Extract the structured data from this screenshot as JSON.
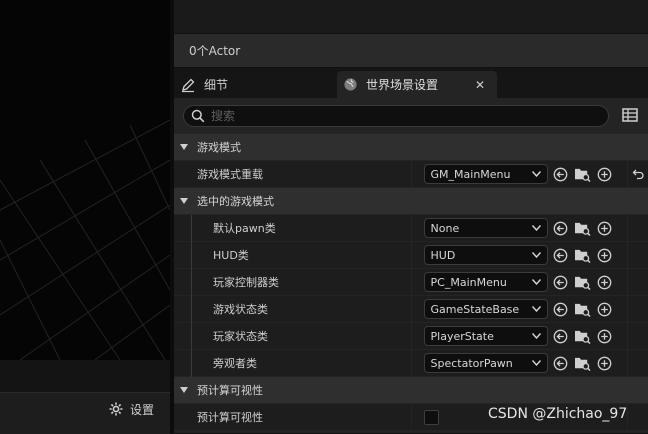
{
  "viewport": {
    "settings_label": "设置"
  },
  "outliner": {
    "status": "0个Actor"
  },
  "tabs": [
    {
      "label": "细节"
    },
    {
      "label": "世界场景设置"
    }
  ],
  "search": {
    "placeholder": "搜索"
  },
  "sections": {
    "game_mode": {
      "label": "游戏模式",
      "override": {
        "label": "游戏模式重载",
        "value": "GM_MainMenu"
      }
    },
    "selected_game_mode": {
      "label": "选中的游戏模式",
      "items": [
        {
          "label": "默认pawn类",
          "value": "None"
        },
        {
          "label": "HUD类",
          "value": "HUD"
        },
        {
          "label": "玩家控制器类",
          "value": "PC_MainMenu"
        },
        {
          "label": "游戏状态类",
          "value": "GameStateBase"
        },
        {
          "label": "玩家状态类",
          "value": "PlayerState"
        },
        {
          "label": "旁观者类",
          "value": "SpectatorPawn"
        }
      ]
    },
    "precomputed_visibility": {
      "label": "预计算可视性",
      "item": {
        "label": "预计算可视性",
        "checked": false
      }
    }
  },
  "watermark": "CSDN @Zhichao_97",
  "icons": {
    "settings": "gear-icon",
    "details_tab": "pencil-icon",
    "world_tab": "globe-icon",
    "close": "close-icon",
    "search": "search-icon",
    "view_options": "table-icon",
    "use_selected": "arrow-left-circle-icon",
    "browse": "folder-search-icon",
    "create": "plus-circle-icon",
    "reset": "reset-arrow-icon"
  },
  "colors": {
    "panel_bg": "#242424",
    "row_bg": "#1d1d1d",
    "category_bg": "#2f2f2f",
    "input_bg": "#0e0e0e",
    "text": "#cfcfcf"
  }
}
